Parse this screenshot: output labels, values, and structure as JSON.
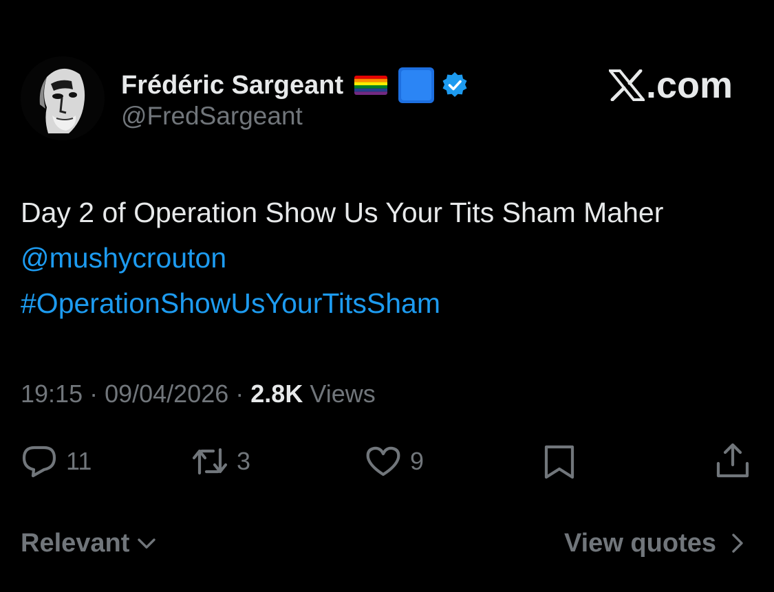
{
  "author": {
    "display_name": "Frédéric Sargeant",
    "handle": "@FredSargeant",
    "badges": [
      "rainbow-flag-emoji",
      "blue-square-emoji",
      "verified-badge-icon"
    ],
    "verified_color": "#1d9bf0"
  },
  "brand": {
    "icon": "x-logo-icon",
    "suffix": ".com"
  },
  "tweet": {
    "text_plain": "Day 2 of Operation Show Us Your Tits Sham Maher",
    "mention": "@mushycrouton",
    "hashtag": "#OperationShowUsYourTitsSham"
  },
  "meta": {
    "time": "19:15",
    "separator_1": " · ",
    "date": "09/04/2026",
    "separator_2": " · ",
    "views_count": "2.8K",
    "views_label": " Views"
  },
  "actions": {
    "reply_count": "11",
    "repost_count": "3",
    "like_count": "9"
  },
  "footer": {
    "sort_label": "Relevant",
    "quotes_label": "View quotes"
  },
  "colors": {
    "background": "#000000",
    "text": "#e7e9ea",
    "muted": "#71767b",
    "link": "#1d9bf0"
  }
}
